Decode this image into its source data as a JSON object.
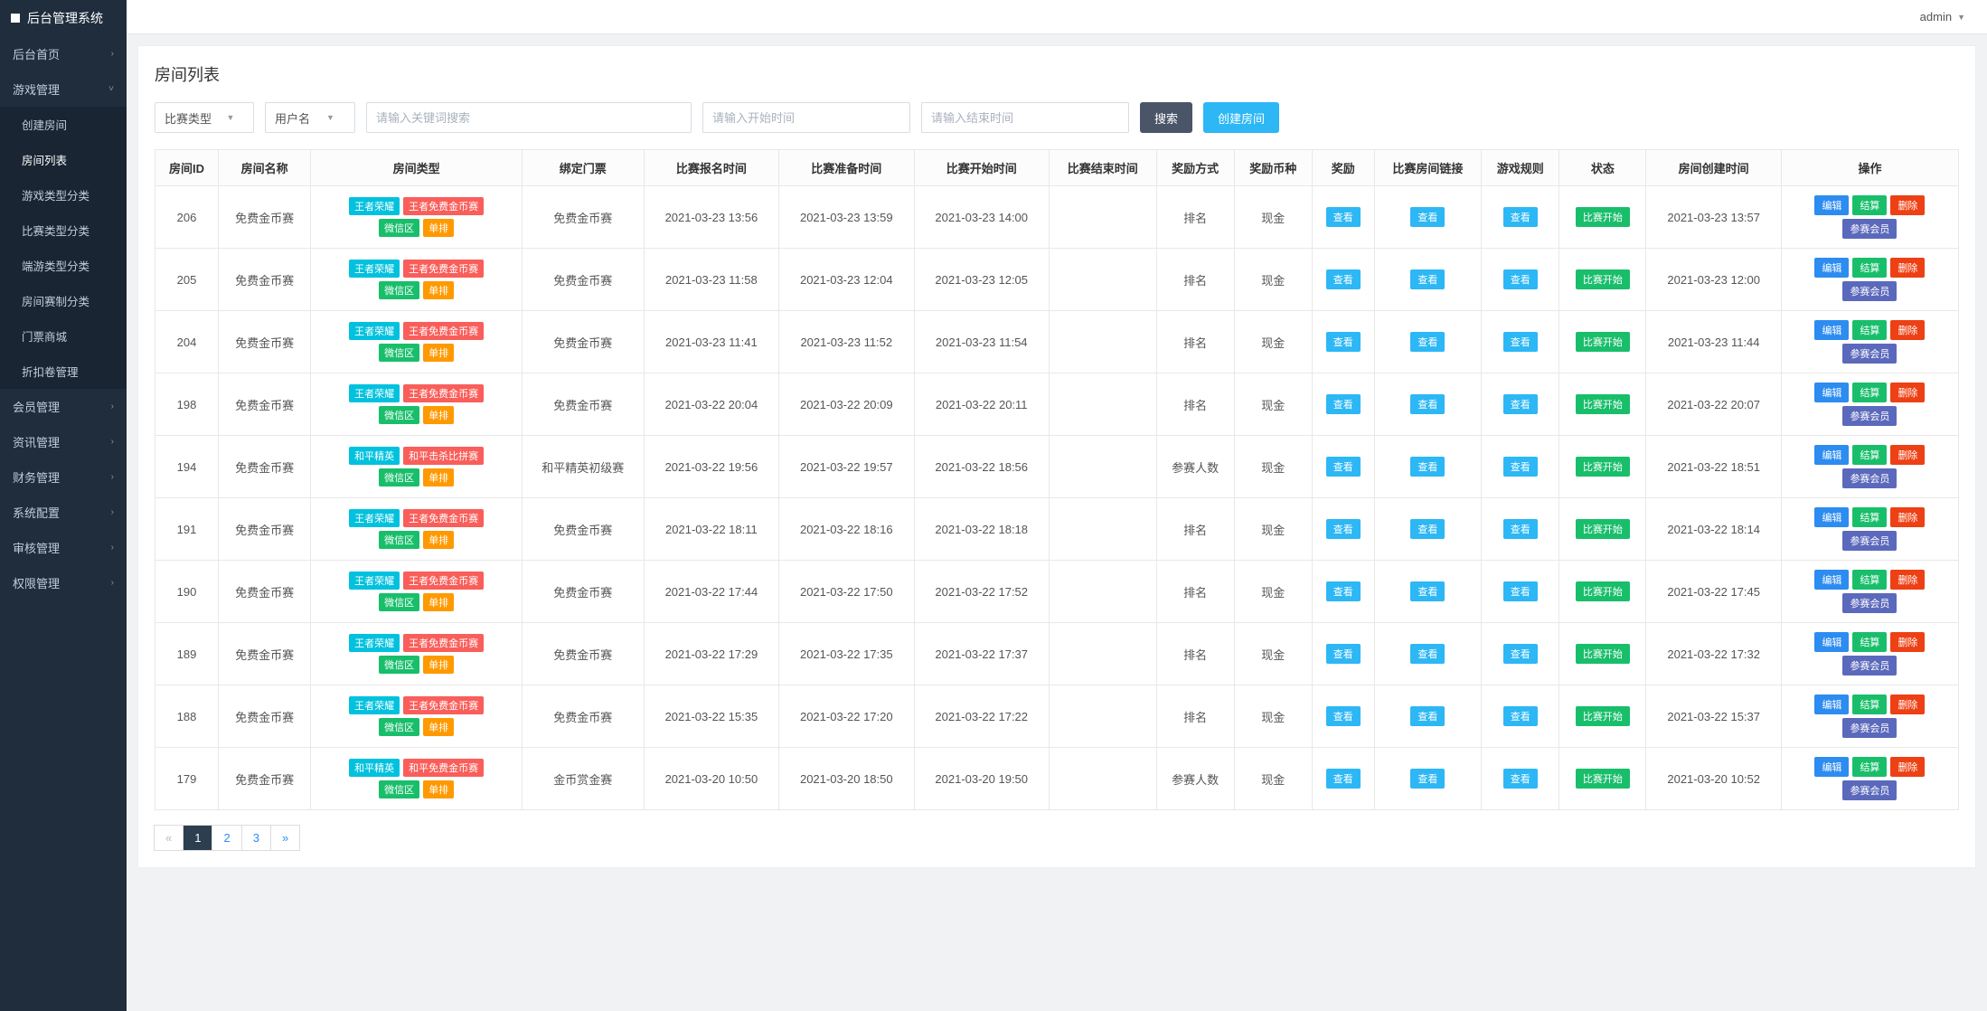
{
  "brand": "后台管理系统",
  "user": {
    "name": "admin"
  },
  "sidebar": {
    "items": [
      {
        "label": "后台首页",
        "expand": true
      },
      {
        "label": "游戏管理",
        "expand": true,
        "open": true,
        "children": [
          {
            "label": "创建房间"
          },
          {
            "label": "房间列表",
            "active": true
          },
          {
            "label": "游戏类型分类"
          },
          {
            "label": "比赛类型分类"
          },
          {
            "label": "端游类型分类"
          },
          {
            "label": "房间赛制分类"
          },
          {
            "label": "门票商城"
          },
          {
            "label": "折扣卷管理"
          }
        ]
      },
      {
        "label": "会员管理",
        "expand": true
      },
      {
        "label": "资讯管理",
        "expand": true
      },
      {
        "label": "财务管理",
        "expand": true
      },
      {
        "label": "系统配置",
        "expand": true
      },
      {
        "label": "审核管理",
        "expand": true
      },
      {
        "label": "权限管理",
        "expand": true
      }
    ]
  },
  "page": {
    "title": "房间列表"
  },
  "filter": {
    "type_label": "比赛类型",
    "user_label": "用户名",
    "keyword_placeholder": "请输入关键词搜索",
    "start_placeholder": "请输入开始时间",
    "end_placeholder": "请输入结束时间",
    "search_btn": "搜索",
    "create_btn": "创建房间"
  },
  "columns": [
    "房间ID",
    "房间名称",
    "房间类型",
    "绑定门票",
    "比赛报名时间",
    "比赛准备时间",
    "比赛开始时间",
    "比赛结束时间",
    "奖励方式",
    "奖励币种",
    "奖励",
    "比赛房间链接",
    "游戏规则",
    "状态",
    "房间创建时间",
    "操作"
  ],
  "common": {
    "view": "查看",
    "status": "比赛开始",
    "ops": {
      "edit": "编辑",
      "settle": "结算",
      "delete": "删除",
      "member": "参赛会员"
    }
  },
  "type_tags": {
    "king": [
      {
        "text": "王者荣耀",
        "cls": "t-cyan"
      },
      {
        "text": "王者免费金币赛",
        "cls": "t-red"
      },
      {
        "text": "微信区",
        "cls": "t-green"
      },
      {
        "text": "单排",
        "cls": "t-orange"
      }
    ],
    "peace1": [
      {
        "text": "和平精英",
        "cls": "t-cyan"
      },
      {
        "text": "和平击杀比拼赛",
        "cls": "t-red"
      },
      {
        "text": "微信区",
        "cls": "t-green"
      },
      {
        "text": "单排",
        "cls": "t-orange"
      }
    ],
    "peace2": [
      {
        "text": "和平精英",
        "cls": "t-cyan"
      },
      {
        "text": "和平免费金币赛",
        "cls": "t-red"
      },
      {
        "text": "微信区",
        "cls": "t-green"
      },
      {
        "text": "单排",
        "cls": "t-orange"
      }
    ]
  },
  "rows": [
    {
      "id": "206",
      "name": "免费金币赛",
      "type_set": "king",
      "ticket": "免费金币赛",
      "t1": "2021-03-23 13:56",
      "t2": "2021-03-23 13:59",
      "t3": "2021-03-23 14:00",
      "t4": "",
      "reward_mode": "排名",
      "currency": "现金",
      "created": "2021-03-23 13:57"
    },
    {
      "id": "205",
      "name": "免费金币赛",
      "type_set": "king",
      "ticket": "免费金币赛",
      "t1": "2021-03-23 11:58",
      "t2": "2021-03-23 12:04",
      "t3": "2021-03-23 12:05",
      "t4": "",
      "reward_mode": "排名",
      "currency": "现金",
      "created": "2021-03-23 12:00"
    },
    {
      "id": "204",
      "name": "免费金币赛",
      "type_set": "king",
      "ticket": "免费金币赛",
      "t1": "2021-03-23 11:41",
      "t2": "2021-03-23 11:52",
      "t3": "2021-03-23 11:54",
      "t4": "",
      "reward_mode": "排名",
      "currency": "现金",
      "created": "2021-03-23 11:44"
    },
    {
      "id": "198",
      "name": "免费金币赛",
      "type_set": "king",
      "ticket": "免费金币赛",
      "t1": "2021-03-22 20:04",
      "t2": "2021-03-22 20:09",
      "t3": "2021-03-22 20:11",
      "t4": "",
      "reward_mode": "排名",
      "currency": "现金",
      "created": "2021-03-22 20:07"
    },
    {
      "id": "194",
      "name": "免费金币赛",
      "type_set": "peace1",
      "ticket": "和平精英初级赛",
      "t1": "2021-03-22 19:56",
      "t2": "2021-03-22 19:57",
      "t3": "2021-03-22 18:56",
      "t4": "",
      "reward_mode": "参赛人数",
      "currency": "现金",
      "created": "2021-03-22 18:51"
    },
    {
      "id": "191",
      "name": "免费金币赛",
      "type_set": "king",
      "ticket": "免费金币赛",
      "t1": "2021-03-22 18:11",
      "t2": "2021-03-22 18:16",
      "t3": "2021-03-22 18:18",
      "t4": "",
      "reward_mode": "排名",
      "currency": "现金",
      "created": "2021-03-22 18:14"
    },
    {
      "id": "190",
      "name": "免费金币赛",
      "type_set": "king",
      "ticket": "免费金币赛",
      "t1": "2021-03-22 17:44",
      "t2": "2021-03-22 17:50",
      "t3": "2021-03-22 17:52",
      "t4": "",
      "reward_mode": "排名",
      "currency": "现金",
      "created": "2021-03-22 17:45"
    },
    {
      "id": "189",
      "name": "免费金币赛",
      "type_set": "king",
      "ticket": "免费金币赛",
      "t1": "2021-03-22 17:29",
      "t2": "2021-03-22 17:35",
      "t3": "2021-03-22 17:37",
      "t4": "",
      "reward_mode": "排名",
      "currency": "现金",
      "created": "2021-03-22 17:32"
    },
    {
      "id": "188",
      "name": "免费金币赛",
      "type_set": "king",
      "ticket": "免费金币赛",
      "t1": "2021-03-22 15:35",
      "t2": "2021-03-22 17:20",
      "t3": "2021-03-22 17:22",
      "t4": "",
      "reward_mode": "排名",
      "currency": "现金",
      "created": "2021-03-22 15:37"
    },
    {
      "id": "179",
      "name": "免费金币赛",
      "type_set": "peace2",
      "ticket": "金币赏金赛",
      "t1": "2021-03-20 10:50",
      "t2": "2021-03-20 18:50",
      "t3": "2021-03-20 19:50",
      "t4": "",
      "reward_mode": "参赛人数",
      "currency": "现金",
      "created": "2021-03-20 10:52"
    }
  ],
  "pagination": {
    "prev": "«",
    "next": "»",
    "pages": [
      "1",
      "2",
      "3"
    ],
    "active": "1"
  }
}
